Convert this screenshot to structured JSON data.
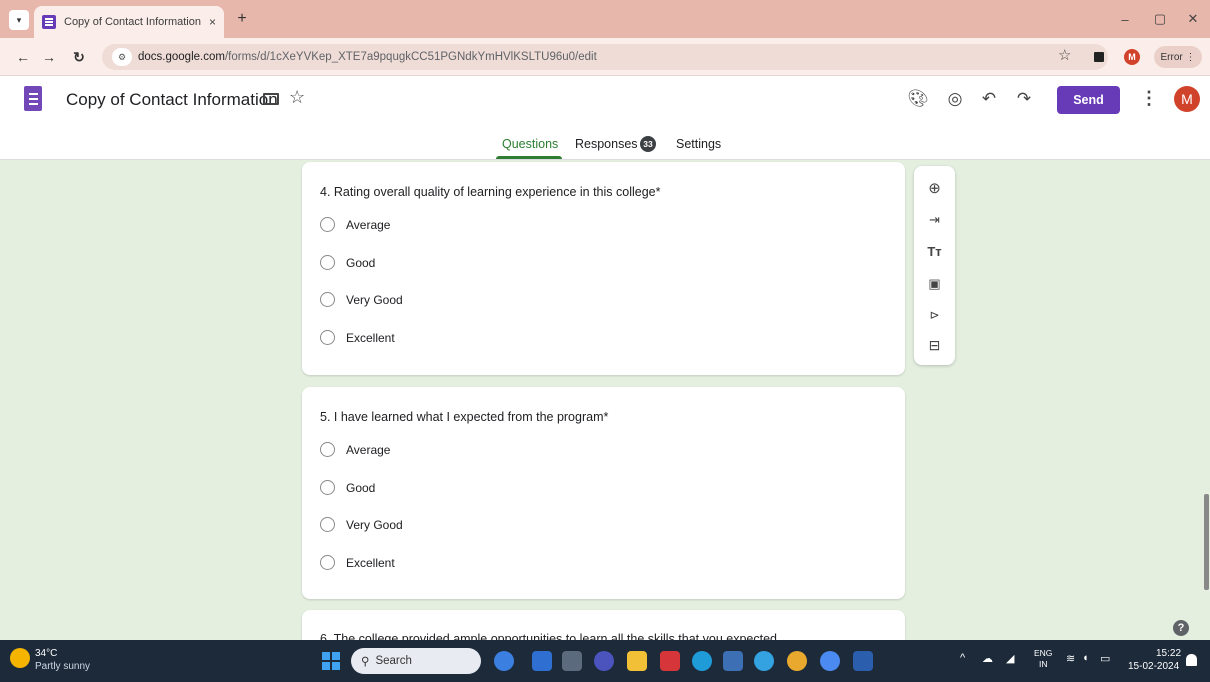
{
  "browser": {
    "tab_title": "Copy of Contact Information - G",
    "tab_close": "×",
    "new_tab": "+",
    "url_host": "docs.google.com",
    "url_path": "/forms/d/1cXeYVKep_XTE7a9pqugkCC51PGNdkYmHVlKSLTU96u0/edit",
    "profile_initial": "M",
    "error_label": "Error",
    "minimize": "–",
    "maximize": "▢",
    "close": "✕"
  },
  "forms_header": {
    "doc_title": "Copy of Contact Information",
    "send_label": "Send",
    "avatar_initial": "M",
    "tabs": [
      {
        "label": "Questions",
        "active": true
      },
      {
        "label": "Responses",
        "badge": "33"
      },
      {
        "label": "Settings"
      }
    ]
  },
  "questions": [
    {
      "title": "4. Rating overall quality of learning experience in this college*",
      "options": [
        "Average",
        "Good",
        "Very Good",
        "Excellent"
      ]
    },
    {
      "title": "5.  I have learned what I expected from  the program*",
      "options": [
        "Average",
        "Good",
        "Very Good",
        "Excellent"
      ]
    },
    {
      "title": "6.  The college provided ample opportunities to learn all the skills that you expected"
    }
  ],
  "side_toolbar": [
    "add-question-icon",
    "import-questions-icon",
    "add-title-icon",
    "add-image-icon",
    "add-video-icon",
    "add-section-icon"
  ],
  "taskbar": {
    "weather_temp": "34°C",
    "weather_desc": "Partly sunny",
    "search_label": "Search",
    "lang_top": "ENG",
    "lang_bottom": "IN",
    "time": "15:22",
    "date": "15-02-2024"
  },
  "colors": {
    "accent": "#673ab7",
    "background": "#e4efe0",
    "active_tab": "#2e7d32",
    "taskbar": "#1c2a3a"
  }
}
